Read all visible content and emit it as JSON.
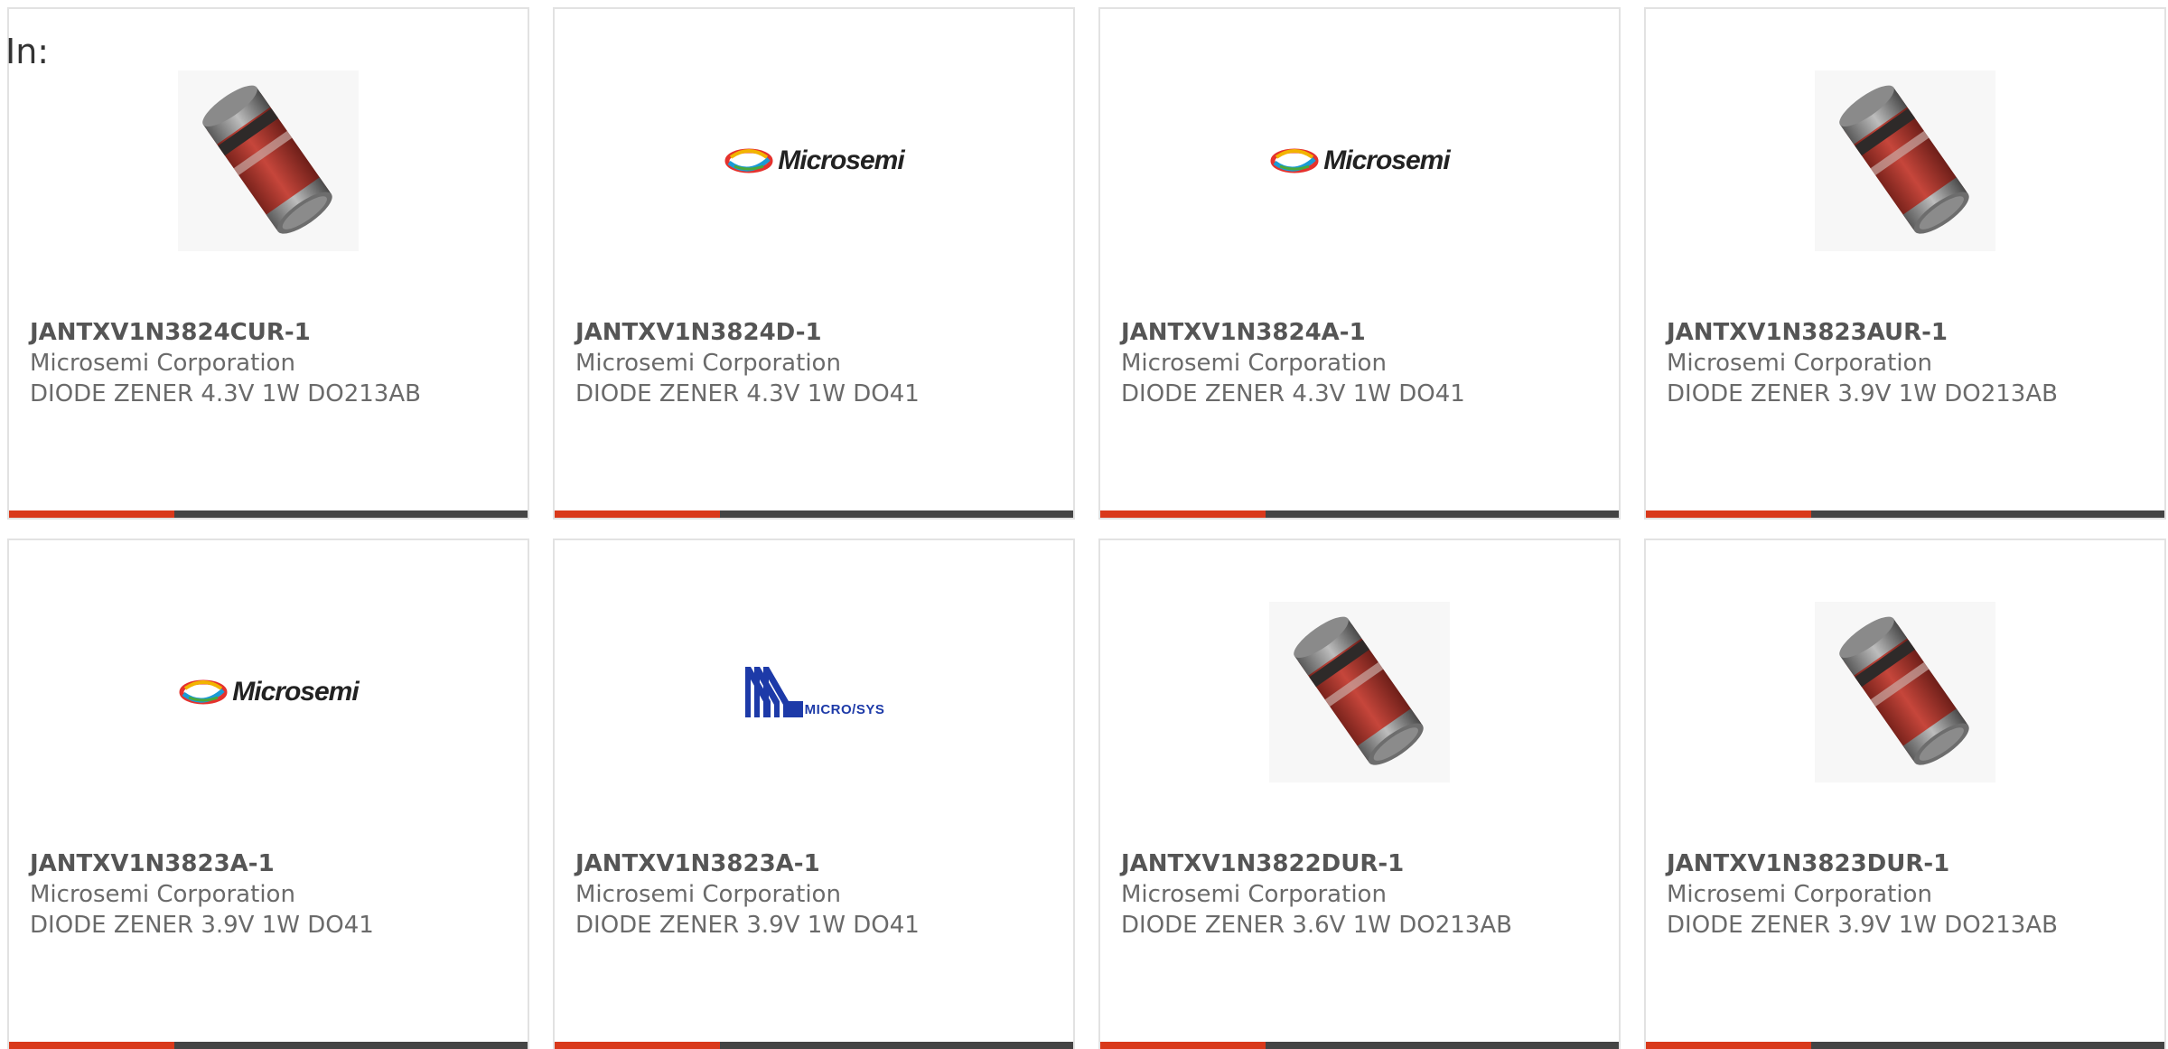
{
  "header": {
    "label": "In:"
  },
  "colors": {
    "accent": "#d9391b",
    "bar": "#444444",
    "card_border": "#e2e2e2"
  },
  "cards": [
    {
      "part_number": "JANTXV1N3824CUR-1",
      "manufacturer": "Microsemi Corporation",
      "description": "DIODE ZENER 4.3V 1W DO213AB",
      "image": "diode-photo"
    },
    {
      "part_number": "JANTXV1N3824D-1",
      "manufacturer": "Microsemi Corporation",
      "description": "DIODE ZENER 4.3V 1W DO41",
      "image": "microsemi-logo",
      "logo_text": "Microsemi"
    },
    {
      "part_number": "JANTXV1N3824A-1",
      "manufacturer": "Microsemi Corporation",
      "description": "DIODE ZENER 4.3V 1W DO41",
      "image": "microsemi-logo",
      "logo_text": "Microsemi"
    },
    {
      "part_number": "JANTXV1N3823AUR-1",
      "manufacturer": "Microsemi Corporation",
      "description": "DIODE ZENER 3.9V 1W DO213AB",
      "image": "diode-photo"
    },
    {
      "part_number": "JANTXV1N3823A-1",
      "manufacturer": "Microsemi Corporation",
      "description": "DIODE ZENER 3.9V 1W DO41",
      "image": "microsemi-logo",
      "logo_text": "Microsemi"
    },
    {
      "part_number": "JANTXV1N3823A-1",
      "manufacturer": "Microsemi Corporation",
      "description": "DIODE ZENER 3.9V 1W DO41",
      "image": "microsys-logo",
      "logo_text": "MICRO/SYS"
    },
    {
      "part_number": "JANTXV1N3822DUR-1",
      "manufacturer": "Microsemi Corporation",
      "description": "DIODE ZENER 3.6V 1W DO213AB",
      "image": "diode-photo"
    },
    {
      "part_number": "JANTXV1N3823DUR-1",
      "manufacturer": "Microsemi Corporation",
      "description": "DIODE ZENER 3.9V 1W DO213AB",
      "image": "diode-photo"
    }
  ]
}
